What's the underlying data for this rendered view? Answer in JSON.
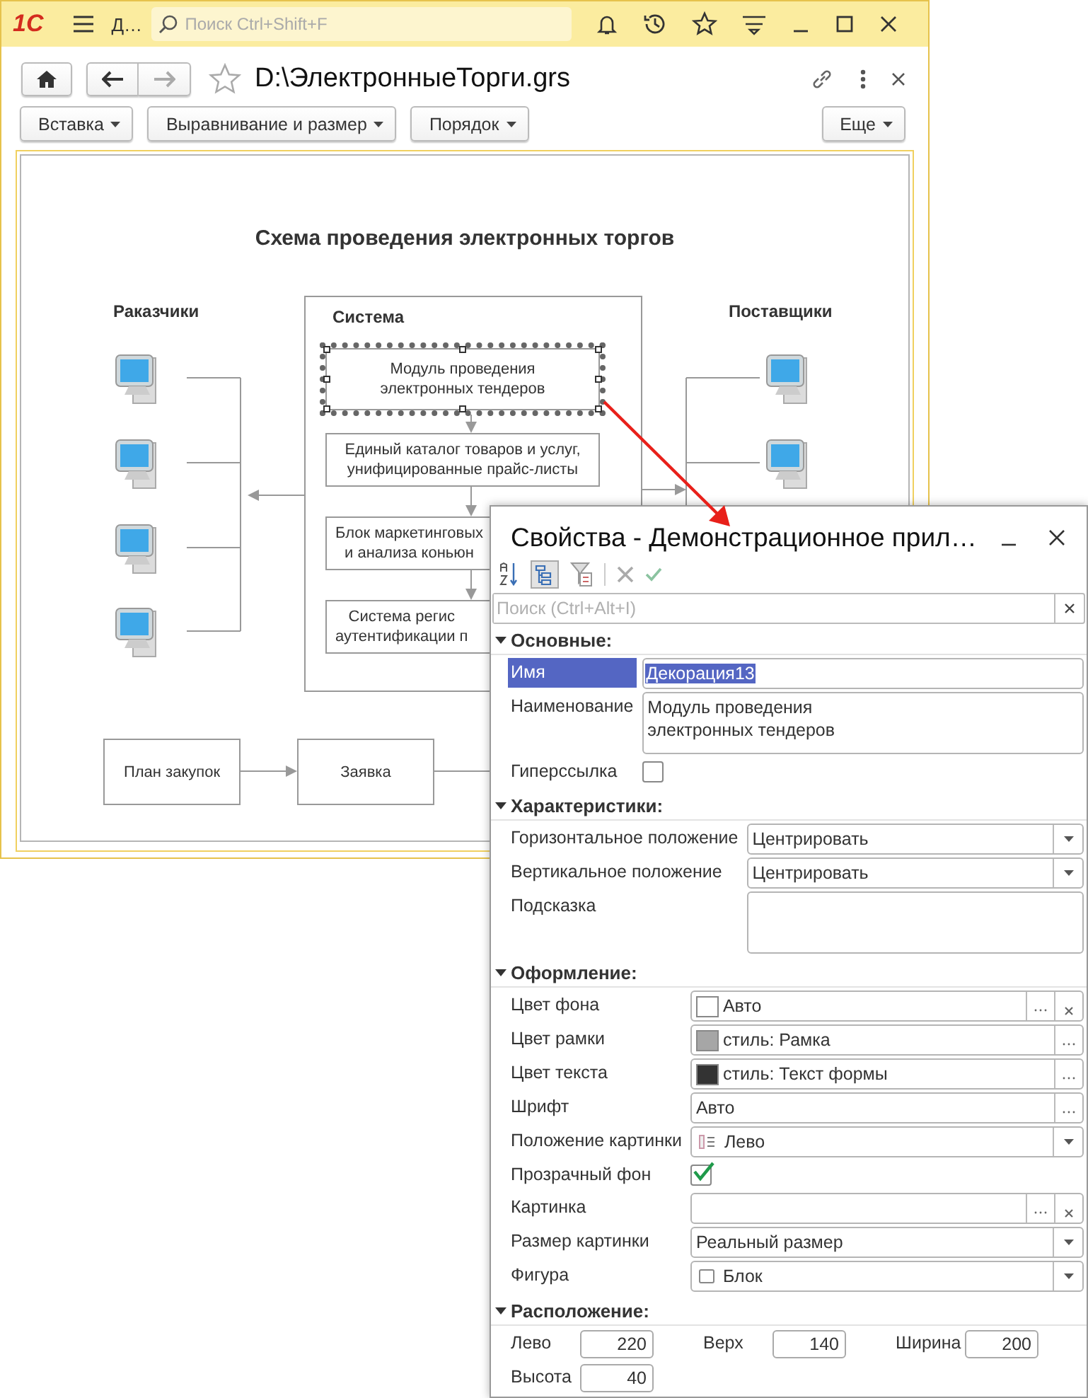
{
  "app_bar": {
    "logo": "1С",
    "title": "Д…",
    "search": {
      "placeholder": "Поиск Ctrl+Shift+F"
    }
  },
  "document": {
    "title": "D:\\ЭлектронныеТорги.grs",
    "toolbar": [
      {
        "label": "Вставка"
      },
      {
        "label": "Выравнивание и размер"
      },
      {
        "label": "Порядок"
      }
    ],
    "more": "Еще"
  },
  "scheme": {
    "title": "Схема проведения электронных торгов",
    "customers": "Раказчики",
    "suppliers": "Поставщики",
    "system": {
      "title": "Система",
      "blocks": [
        {
          "text": "Модуль проведения\nэлектронных тендеров",
          "selected": true,
          "cut": false
        },
        {
          "text": "Единый каталог товаров и услуг,\nунифицированные прайс-листы",
          "selected": false,
          "cut": false
        },
        {
          "text": "Блок маркетинговых\nи анализа коньюн",
          "selected": false,
          "cut": true
        },
        {
          "text": "Система регис\nаутентификации п",
          "selected": false,
          "cut": true
        }
      ]
    },
    "flow": [
      "План закупок",
      "Заявка"
    ]
  },
  "properties": {
    "title": "Свойства - Демонстрационное прил…",
    "search": {
      "placeholder": "Поиск (Ctrl+Alt+I)"
    },
    "groups": [
      {
        "title": "Основные:",
        "expanded": true,
        "rows": [
          {
            "kind": "field",
            "label": "Имя",
            "value": "Декорация13",
            "selected": true
          },
          {
            "kind": "textarea",
            "label": "Наименование",
            "value": "Модуль проведения\nэлектронных тендеров",
            "selected": false
          },
          {
            "kind": "checkbox",
            "label": "Гиперссылка",
            "checked": false,
            "selected": false
          }
        ]
      },
      {
        "title": "Характеристики:",
        "expanded": true,
        "rows": [
          {
            "kind": "select",
            "label": "Горизонтальное положение",
            "value": "Центрировать",
            "selected": false
          },
          {
            "kind": "select",
            "label": "Вертикальное положение",
            "value": "Центрировать",
            "selected": false
          },
          {
            "kind": "textarea",
            "label": "Подсказка",
            "selected": false
          }
        ]
      },
      {
        "title": "Оформление:",
        "expanded": true,
        "rows": [
          {
            "kind": "field",
            "label": "Цвет фона",
            "value": "Авто",
            "color": "#ffffff",
            "choose": true,
            "clear": true,
            "selected": false
          },
          {
            "kind": "field",
            "label": "Цвет рамки",
            "value": "стиль: Рамка",
            "color": "#a6a6a6",
            "choose": true,
            "selected": false
          },
          {
            "kind": "field",
            "label": "Цвет текста",
            "value": "стиль: Текст формы",
            "color": "#333333",
            "choose": true,
            "selected": false
          },
          {
            "kind": "field",
            "label": "Шрифт",
            "value": "Авто",
            "choose": true,
            "selected": false
          },
          {
            "kind": "alignment",
            "label": "Положение картинки",
            "value": "Лево",
            "selected": false
          },
          {
            "kind": "checkbox",
            "label": "Прозрачный фон",
            "checked": true,
            "selected": false
          },
          {
            "kind": "field",
            "label": "Картинка",
            "choose": true,
            "clear": true,
            "selected": false
          },
          {
            "kind": "select",
            "label": "Размер картинки",
            "value": "Реальный размер",
            "selected": false
          },
          {
            "kind": "shape",
            "label": "Фигура",
            "value": "Блок",
            "selected": false
          }
        ]
      },
      {
        "title": "Расположение:",
        "expanded": true,
        "kind": "coords",
        "items": [
          {
            "label": "Лево",
            "value": "220"
          },
          {
            "label": "Верх",
            "value": "140"
          },
          {
            "label": "Ширина",
            "value": "200"
          },
          {
            "label": "Высота",
            "value": "40"
          }
        ]
      }
    ]
  }
}
